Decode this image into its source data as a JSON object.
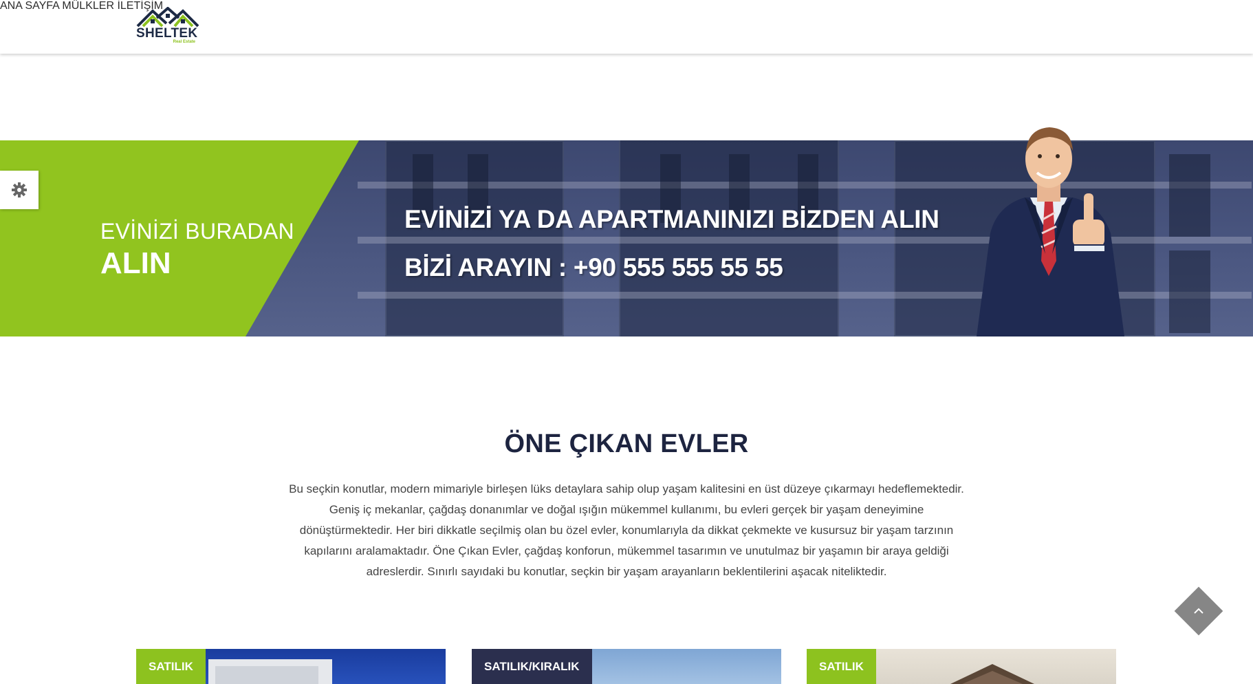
{
  "header": {
    "logo_text": "SHELTEK",
    "logo_subtext": "Real Estate",
    "nav": [
      {
        "label": "ANA SAYFA"
      },
      {
        "label": "MÜLKLER"
      },
      {
        "label": "İLETİŞİM"
      }
    ]
  },
  "banner": {
    "left_line1": "EVİNİZİ BURADAN",
    "left_line2": "ALIN",
    "headline": "EVİNİZİ YA DA APARTMANINIZI BİZDEN ALIN",
    "phone_line": "BİZİ ARAYIN : +90 555 555 55 55"
  },
  "featured": {
    "title": "ÖNE ÇIKAN EVLER",
    "description": "Bu seçkin konutlar, modern mimariyle birleşen lüks detaylara sahip olup yaşam kalitesini en üst düzeye çıkarmayı hedeflemektedir. Geniş iç mekanlar, çağdaş donanımlar ve doğal ışığın mükemmel kullanımı, bu evleri gerçek bir yaşam deneyimine dönüştürmektedir. Her biri dikkatle seçilmiş olan bu özel evler, konumlarıyla da dikkat çekmekte ve kusursuz bir yaşam tarzının kapılarını aralamaktadır. Öne Çıkan Evler, çağdaş konforun, mükemmel tasarımın ve unutulmaz bir yaşamın bir araya geldiği adreslerdir. Sınırlı sayıdaki bu konutlar, seçkin bir yaşam arayanların beklentilerini aşacak niteliktedir."
  },
  "cards": [
    {
      "badge": "SATILIK",
      "badge_color": "#8dc21f"
    },
    {
      "badge": "SATILIK/KIRALIK",
      "badge_color": "#2b2f4e"
    },
    {
      "badge": "SATILIK",
      "badge_color": "#8dc21f"
    }
  ],
  "colors": {
    "accent_green": "#91c41f",
    "navy": "#1d2440",
    "banner_blue": "#4a5680"
  },
  "icons": {
    "settings": "gear-icon",
    "scroll_top": "chevron-up-icon"
  }
}
